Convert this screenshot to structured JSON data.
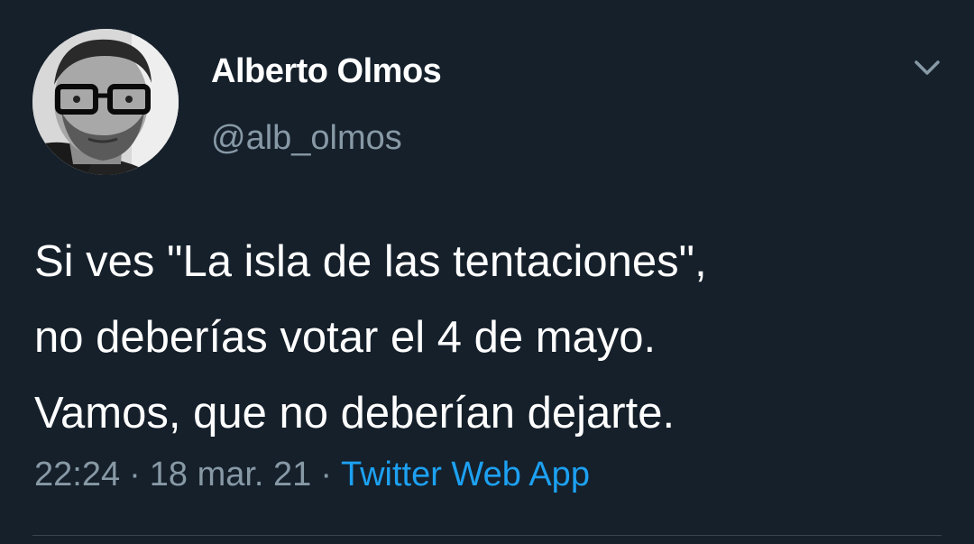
{
  "author": {
    "display_name": "Alberto Olmos",
    "handle": "@alb_olmos",
    "avatar_icon": "person-photo-avatar"
  },
  "menu": {
    "icon": "chevron-down-icon"
  },
  "tweet": {
    "lines": [
      "Si ves \"La isla de las tentaciones\",",
      "no deberías votar el 4 de mayo.",
      "Vamos, que no deberían dejarte."
    ]
  },
  "meta": {
    "time": "22:24",
    "date": "18 mar. 21",
    "separator": "·",
    "source": "Twitter Web App"
  },
  "colors": {
    "background": "#15202b",
    "primary_text": "#ffffff",
    "secondary_text": "#8899a6",
    "accent": "#1da1f2",
    "divider": "#38444d"
  }
}
